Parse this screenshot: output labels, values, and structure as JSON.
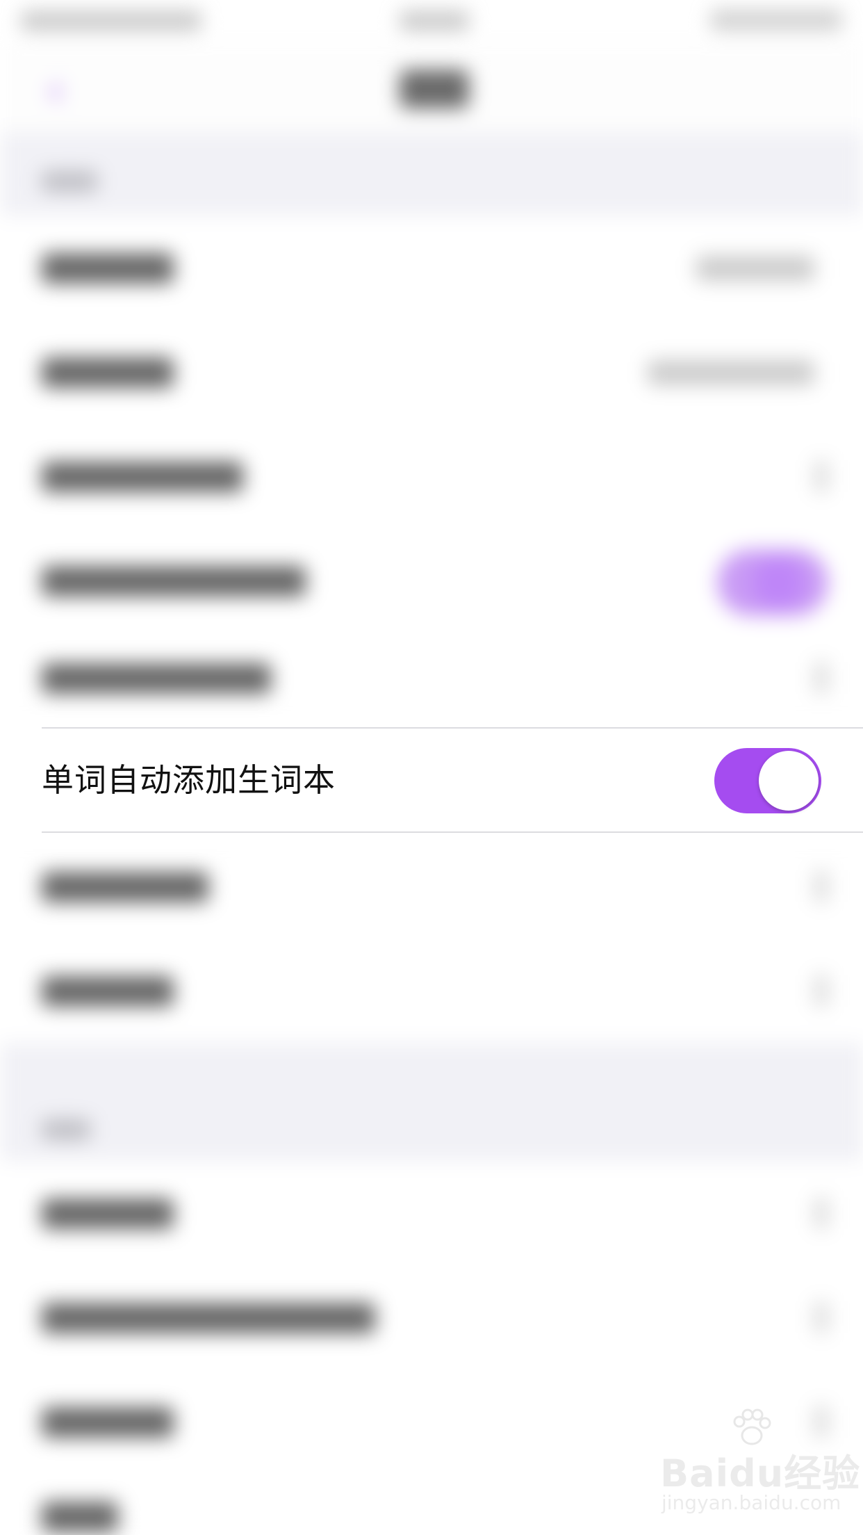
{
  "focused_setting": {
    "label": "单词自动添加生词本",
    "toggle_on": true
  },
  "colors": {
    "accent": "#A54CF0",
    "background": "#FFFFFF",
    "section_background": "#F1F1F6",
    "divider": "#DCDCE0"
  },
  "icons": {
    "back": "chevron-left-icon",
    "toggle": "toggle-switch"
  },
  "watermark": {
    "brand": "Baidu经验",
    "url": "jingyan.baidu.com"
  }
}
